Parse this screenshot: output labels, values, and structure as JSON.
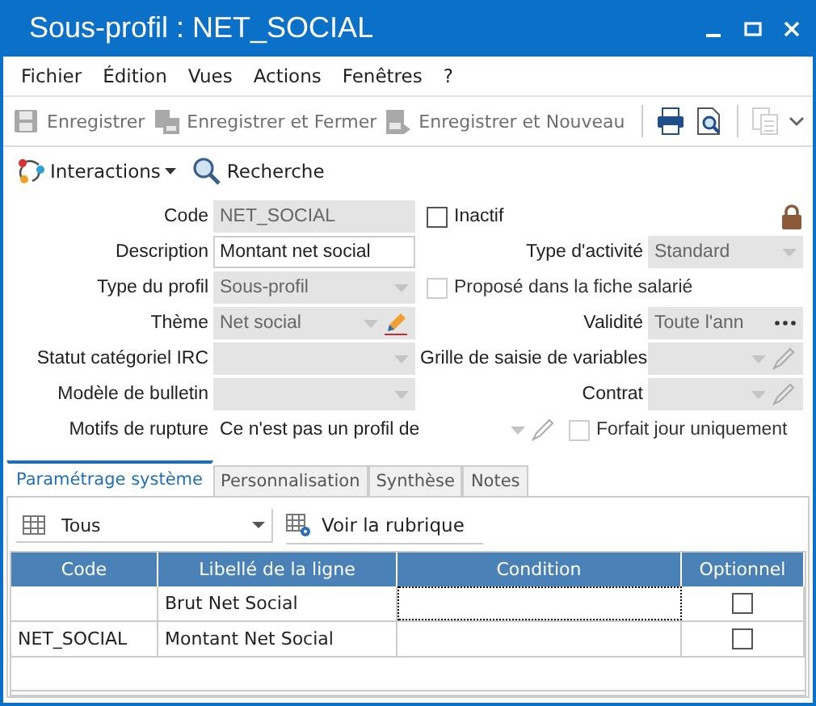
{
  "window": {
    "title": "Sous-profil : NET_SOCIAL"
  },
  "menu": [
    "Fichier",
    "Édition",
    "Vues",
    "Actions",
    "Fenêtres",
    "?"
  ],
  "toolbar": [
    {
      "kind": "save",
      "label": "Enregistrer",
      "disabled": true
    },
    {
      "kind": "save-close",
      "label": "Enregistrer et Fermer",
      "disabled": true
    },
    {
      "kind": "save-new",
      "label": "Enregistrer et Nouveau",
      "disabled": true
    },
    {
      "kind": "separator"
    },
    {
      "kind": "print",
      "disabled": false
    },
    {
      "kind": "preview",
      "disabled": false
    },
    {
      "kind": "separator"
    },
    {
      "kind": "paste",
      "disabled": true
    }
  ],
  "toolbar2": [
    {
      "kind": "interactions",
      "label": "Interactions",
      "dropdown": true
    },
    {
      "kind": "search",
      "label": "Recherche",
      "dropdown": false
    }
  ],
  "form": {
    "locked": true,
    "rows": [
      {
        "left": {
          "kind": "text",
          "label": "Code",
          "value": "NET_SOCIAL",
          "disabled": true
        },
        "right": {
          "kind": "checkbox",
          "label": "Inactif",
          "checked": false,
          "disabled": false
        }
      },
      {
        "left": {
          "kind": "text",
          "label": "Description",
          "value": "Montant net social",
          "disabled": false
        },
        "right": {
          "kind": "combo",
          "label": "Type d'activité",
          "value": "Standard",
          "disabled": true
        }
      },
      {
        "left": {
          "kind": "combo",
          "label": "Type du profil",
          "value": "Sous-profil",
          "disabled": true
        },
        "right": {
          "kind": "checkbox",
          "label": "Proposé dans la fiche salarié",
          "checked": false,
          "disabled": true
        }
      },
      {
        "left": {
          "kind": "combo",
          "label": "Thème",
          "value": "Net social",
          "disabled": true,
          "has_editor": true,
          "editor_enabled": true
        },
        "right": {
          "kind": "picker",
          "label": "Validité",
          "value": "Toute l'ann",
          "disabled": true
        }
      },
      {
        "left": {
          "kind": "combo",
          "label": "Statut catégoriel IRC",
          "disabled": true
        },
        "right": {
          "kind": "combo",
          "label": "Grille de saisie de variables",
          "disabled": true,
          "has_editor": true,
          "editor_enabled": false
        }
      },
      {
        "left": {
          "kind": "combo",
          "label": "Modèle de bulletin",
          "disabled": true
        },
        "right": {
          "kind": "combo",
          "label": "Contrat",
          "disabled": true,
          "has_editor": true,
          "editor_enabled": false
        }
      },
      {
        "left": {
          "kind": "wide-combo",
          "label": "Motifs de rupture",
          "value": "Ce n'est pas un profil de",
          "disabled": false,
          "has_editor": true,
          "editor_enabled": false
        },
        "right": {
          "kind": "checkbox",
          "label": "Forfait jour uniquement",
          "checked": false,
          "disabled": true
        }
      }
    ]
  },
  "tabs": [
    {
      "label": "Paramétrage système",
      "selected": true
    },
    {
      "label": "Personnalisation",
      "selected": false
    },
    {
      "label": "Synthèse",
      "selected": false
    },
    {
      "label": "Notes",
      "selected": false
    }
  ],
  "filter": {
    "value": "Tous"
  },
  "view_button": {
    "label": "Voir la rubrique"
  },
  "table": {
    "columns": [
      "Code",
      "Libellé de la ligne",
      "Condition",
      "Optionnel"
    ],
    "rows": [
      {
        "code": "",
        "label": "Brut Net Social",
        "condition_focused": true,
        "optional": false
      },
      {
        "code": "NET_SOCIAL",
        "label": "Montant Net Social",
        "condition_focused": false,
        "optional": false
      }
    ]
  }
}
